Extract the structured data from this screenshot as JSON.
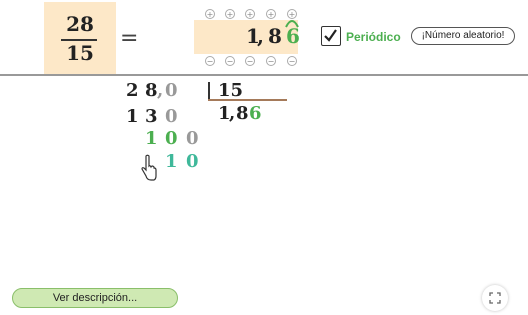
{
  "fraction": {
    "numerator": "28",
    "denominator": "15"
  },
  "equals": "=",
  "result": {
    "integer": "1",
    "comma": ",",
    "digit1": "8",
    "digit2": "6"
  },
  "steppers": {
    "plus": "+",
    "minus": "−"
  },
  "periodic": {
    "checked": true,
    "label": "Periódico"
  },
  "random_button": {
    "label": "¡Número aleatorio!"
  },
  "division": {
    "dividend": [
      "2",
      "8",
      ",",
      "0"
    ],
    "divisor": "15",
    "quotient": [
      "1",
      ",",
      "8",
      "6"
    ],
    "row2": [
      "1",
      "3",
      "0"
    ],
    "row3": [
      "1",
      "0",
      "0"
    ],
    "row4": [
      "1",
      "0"
    ]
  },
  "description_button": {
    "label": "Ver descripción..."
  },
  "icons": {
    "fullscreen": "fullscreen-icon",
    "hand": "hand-pointer-icon",
    "check": "check-icon"
  },
  "colors": {
    "accent_green": "#4caf50",
    "box_fill": "#fde8c8",
    "teal": "#3fb89a"
  }
}
